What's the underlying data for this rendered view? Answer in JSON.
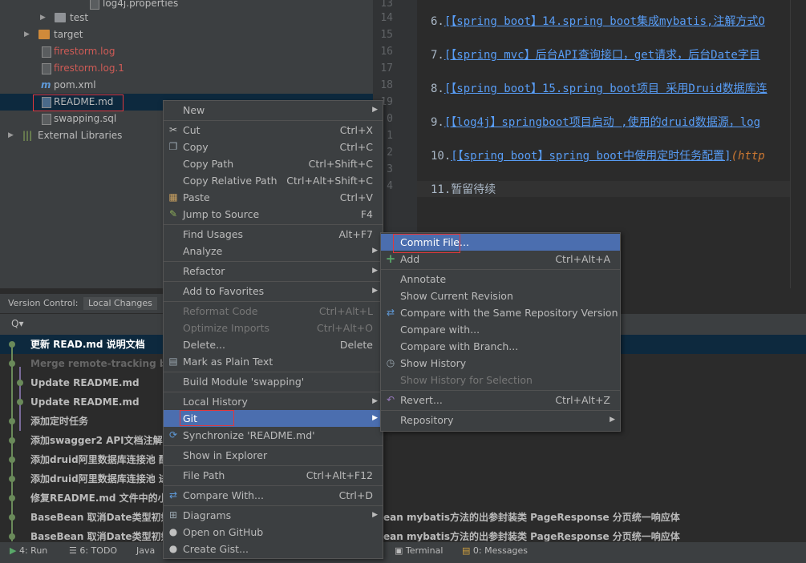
{
  "project_tree": {
    "items": [
      {
        "label": "log4j.properties",
        "color": "#bbbbbb"
      },
      {
        "label": "test",
        "color": "#bbbbbb"
      },
      {
        "label": "target",
        "color": "#bbbbbb"
      },
      {
        "label": "firestorm.log",
        "color": "#cf5b56"
      },
      {
        "label": "firestorm.log.1",
        "color": "#cf5b56"
      },
      {
        "label": "pom.xml",
        "color": "#bbbbbb"
      },
      {
        "label": "README.md",
        "color": "#bbbbbb"
      },
      {
        "label": "swapping.sql",
        "color": "#bbbbbb"
      },
      {
        "label": "External Libraries",
        "color": "#bbbbbb"
      }
    ]
  },
  "editor": {
    "line_numbers": [
      "13",
      "14",
      "15",
      "16",
      "17",
      "18",
      "19",
      "0",
      "1",
      "2",
      "3",
      "4"
    ],
    "lines": [
      {
        "num": "6.",
        "link": "[【spring boot】14.spring boot集成mybatis,注解方式O"
      },
      {
        "num": "7.",
        "link": "[【spring mvc】后台API查询接口，get请求，后台Date字目"
      },
      {
        "num": "8.",
        "link": "[【spring boot】15.spring boot项目 采用Druid数据库连"
      },
      {
        "num": "9.",
        "link": "[【log4j】springboot项目启动 ,使用的druid数据源，log"
      },
      {
        "num": "10.",
        "link": "[【spring boot】spring boot中使用定时任务配置]",
        "url": "(http"
      },
      {
        "num": "11.",
        "text": "暂留待续"
      }
    ]
  },
  "version_control": {
    "tabs": [
      "Version Control:",
      "Local Changes"
    ],
    "search_placeholder": "Q▾",
    "commits": [
      "更新 READ.md  说明文档",
      "Merge remote-tracking bra",
      "Update README.md",
      "Update README.md",
      "添加定时任务",
      "添加swagger2  API文档注解功",
      "添加druid阿里数据库连接池 配",
      "添加druid阿里数据库连接池 进",
      "修复README.md 文件中的小",
      "BaseBean 取消Date类型初始化",
      "BaseBean 取消Date类型初始化"
    ],
    "right_commit_text": "ean mybatis方法的出参封装类 PageResponse  分页统一响应体"
  },
  "status_bar": {
    "items": [
      "4: Run",
      "6: TODO",
      "Java",
      "Terminal",
      "0: Messages"
    ]
  },
  "context_menu": {
    "items": [
      {
        "label": "New",
        "shortcut": "",
        "submenu": true,
        "icon": ""
      },
      {
        "label": "Cut",
        "shortcut": "Ctrl+X",
        "icon": "scissors-icon"
      },
      {
        "label": "Copy",
        "shortcut": "Ctrl+C",
        "icon": "copy-icon"
      },
      {
        "label": "Copy Path",
        "shortcut": "Ctrl+Shift+C",
        "icon": ""
      },
      {
        "label": "Copy Relative Path",
        "shortcut": "Ctrl+Alt+Shift+C",
        "icon": ""
      },
      {
        "label": "Paste",
        "shortcut": "Ctrl+V",
        "icon": "paste-icon"
      },
      {
        "label": "Jump to Source",
        "shortcut": "F4",
        "icon": "jump-icon"
      },
      {
        "label": "Find Usages",
        "shortcut": "Alt+F7",
        "icon": ""
      },
      {
        "label": "Analyze",
        "shortcut": "",
        "submenu": true,
        "icon": ""
      },
      {
        "label": "Refactor",
        "shortcut": "",
        "submenu": true,
        "icon": ""
      },
      {
        "label": "Add to Favorites",
        "shortcut": "",
        "submenu": true,
        "icon": ""
      },
      {
        "label": "Reformat Code",
        "shortcut": "Ctrl+Alt+L",
        "disabled": true,
        "icon": ""
      },
      {
        "label": "Optimize Imports",
        "shortcut": "Ctrl+Alt+O",
        "disabled": true,
        "icon": ""
      },
      {
        "label": "Delete...",
        "shortcut": "Delete",
        "icon": ""
      },
      {
        "label": "Mark as Plain Text",
        "shortcut": "",
        "icon": "plain-text-icon"
      },
      {
        "label": "Build Module 'swapping'",
        "shortcut": "",
        "icon": ""
      },
      {
        "label": "Local History",
        "shortcut": "",
        "submenu": true,
        "icon": ""
      },
      {
        "label": "Git",
        "shortcut": "",
        "submenu": true,
        "icon": "",
        "highlighted": true
      },
      {
        "label": "Synchronize 'README.md'",
        "shortcut": "",
        "icon": "sync-icon"
      },
      {
        "label": "Show in Explorer",
        "shortcut": "",
        "icon": ""
      },
      {
        "label": "File Path",
        "shortcut": "Ctrl+Alt+F12",
        "icon": ""
      },
      {
        "label": "Compare With...",
        "shortcut": "Ctrl+D",
        "icon": "compare-icon"
      },
      {
        "label": "Diagrams",
        "shortcut": "",
        "submenu": true,
        "icon": "diagram-icon"
      },
      {
        "label": "Open on GitHub",
        "shortcut": "",
        "icon": "github-icon"
      },
      {
        "label": "Create Gist...",
        "shortcut": "",
        "icon": "github-icon"
      }
    ]
  },
  "git_submenu": {
    "items": [
      {
        "label": "Commit File...",
        "shortcut": "",
        "highlighted": true
      },
      {
        "label": "Add",
        "shortcut": "Ctrl+Alt+A",
        "icon": "plus-icon"
      },
      {
        "label": "Annotate",
        "shortcut": ""
      },
      {
        "label": "Show Current Revision",
        "shortcut": ""
      },
      {
        "label": "Compare with the Same Repository Version",
        "shortcut": "",
        "icon": "compare-icon"
      },
      {
        "label": "Compare with...",
        "shortcut": ""
      },
      {
        "label": "Compare with Branch...",
        "shortcut": ""
      },
      {
        "label": "Show History",
        "shortcut": "",
        "icon": "history-icon"
      },
      {
        "label": "Show History for Selection",
        "shortcut": "",
        "disabled": true
      },
      {
        "label": "Revert...",
        "shortcut": "Ctrl+Alt+Z",
        "icon": "revert-icon"
      },
      {
        "label": "Repository",
        "shortcut": "",
        "submenu": true
      }
    ]
  },
  "colors": {
    "highlight": "#4b6eaf",
    "annotation_red": "#e0383c",
    "link": "#589df6"
  }
}
